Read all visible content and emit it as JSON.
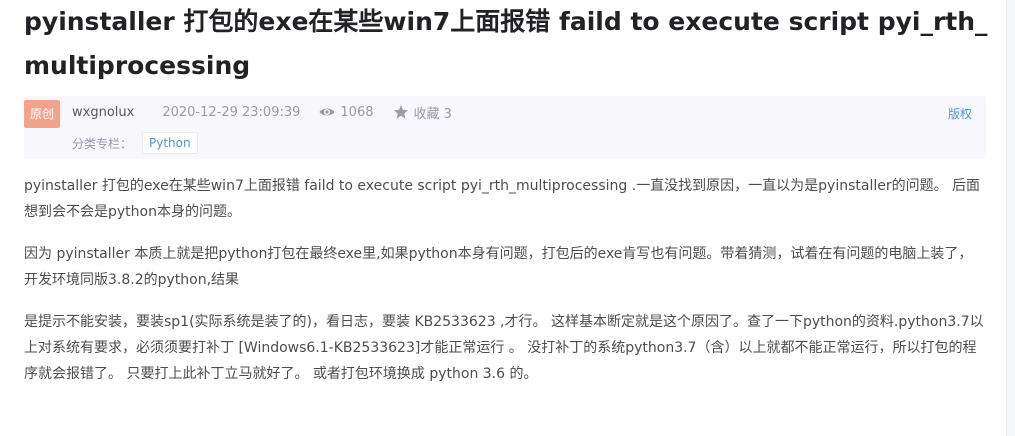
{
  "article": {
    "title": "pyinstaller 打包的exe在某些win7上面报错   faild to execute script pyi_rth_multiprocessing"
  },
  "meta": {
    "badge": "原创",
    "author": "wxgnolux",
    "date": "2020-12-29 23:09:39",
    "views": "1068",
    "favorites": "收藏 3",
    "copyright": "版权",
    "category_label": "分类专栏：",
    "category_tag": "Python",
    "icons": [
      "eye-icon",
      "star-icon"
    ]
  },
  "content": {
    "paragraphs": [
      "pyinstaller 打包的exe在某些win7上面报错 faild to execute script pyi_rth_multiprocessing  .一直没找到原因，一直以为是pyinstaller的问题。    后面想到会不会是python本身的问题。",
      "因为 pyinstaller 本质上就是把python打包在最终exe里,如果python本身有问题，打包后的exe肯写也有问题。带着猜测，试着在有问题的电脑上装了，开发环境同版3.8.2的python,结果",
      "是提示不能安装，要装sp1(实际系统是装了的)，看日志，要装 KB2533623 ,才行。    这样基本断定就是这个原因了。查了一下python的资料.python3.7以上对系统有要求，必须须要打补丁      [Windows6.1-KB2533623]才能正常运行    。    没打补丁的系统python3.7（含）以上就都不能正常运行，所以打包的程序就会报错了。    只要打上此补丁立马就好了。    或者打包环境换成 python 3.6 的。"
    ]
  },
  "colors": {
    "accent": "#5094d5",
    "badge": "#f4a28c",
    "meta_bg": "#f7f7fc"
  }
}
